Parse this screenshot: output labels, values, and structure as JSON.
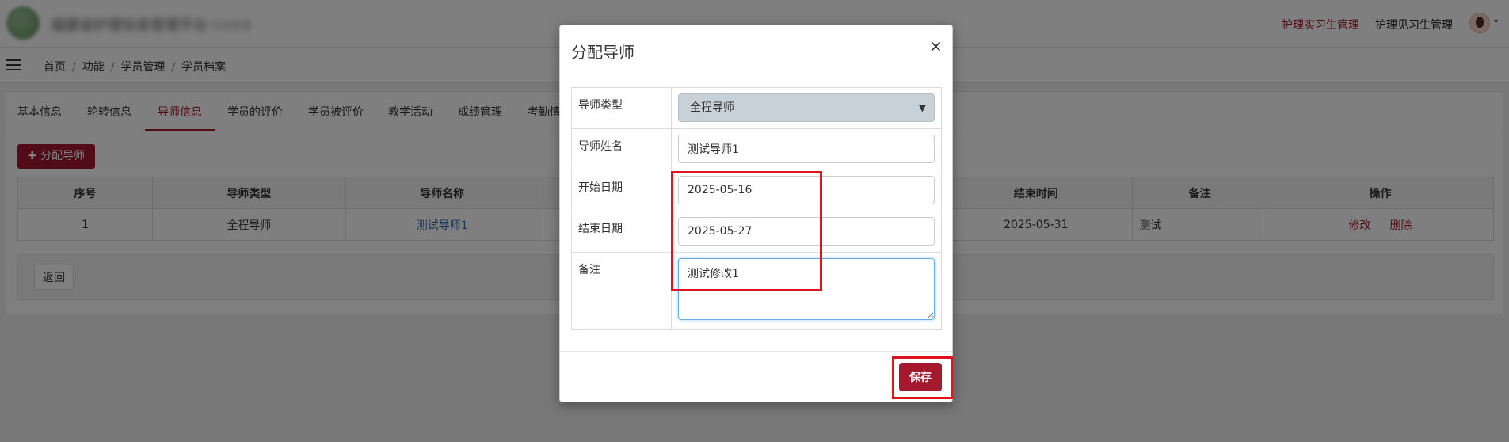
{
  "header": {
    "org_name": "福建省护理信息管理平台",
    "org_sub": "学员管理",
    "nav": [
      "护理实习生管理",
      "护理见习生管理"
    ],
    "caret": "▾"
  },
  "breadcrumb": [
    "首页",
    "功能",
    "学员管理",
    "学员档案"
  ],
  "tabs": [
    "基本信息",
    "轮转信息",
    "导师信息",
    "学员的评价",
    "学员被评价",
    "教学活动",
    "成绩管理",
    "考勤情"
  ],
  "toolbar": {
    "add_label": "分配导师",
    "add_icon": "✚"
  },
  "table": {
    "headers": [
      "序号",
      "导师类型",
      "导师名称",
      "",
      "结束时间",
      "备注",
      "操作"
    ],
    "rows": [
      {
        "index": "1",
        "type": "全程导师",
        "name": "测试导师1",
        "end": "2025-05-31",
        "note": "测试",
        "edit": "修改",
        "delete": "删除"
      }
    ]
  },
  "back_label": "返回",
  "modal": {
    "title": "分配导师",
    "close": "×",
    "fields": {
      "type_label": "导师类型",
      "type_value": "全程导师",
      "name_label": "导师姓名",
      "name_value": "测试导师1",
      "start_label": "开始日期",
      "start_value": "2025-05-16",
      "end_label": "结束日期",
      "end_value": "2025-05-27",
      "note_label": "备注",
      "note_value": "测试修改1"
    },
    "save_label": "保存"
  },
  "colors": {
    "brand": "#a4192e",
    "link": "#3a6fb0",
    "highlight": "#e0141e"
  }
}
